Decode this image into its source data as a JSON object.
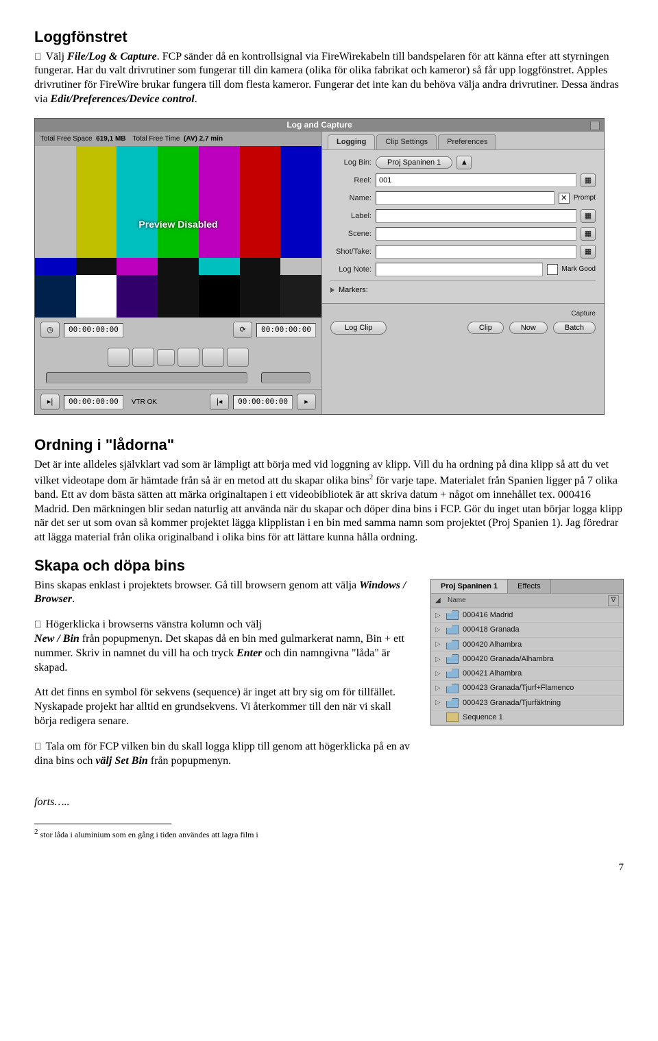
{
  "heading1": "Loggfönstret",
  "para1_prefix": " Välj ",
  "para1_cmd": "File/Log & Capture",
  "para1_body": ". FCP sänder då en kontrollsignal via FireWirekabeln till bandspelaren för att känna efter att styrningen fungerar. Har du valt drivrutiner som fungerar till din kamera (olika för olika fabrikat och kameror) så får upp loggfönstret. Apples drivrutiner för FireWire brukar fungera till dom flesta kameror. Fungerar det inte kan du behöva välja andra drivrutiner. Dessa ändras via ",
  "para1_cmd2": "Edit/Preferences/Device control",
  "para1_end": ".",
  "logcap": {
    "title": "Log and Capture",
    "free_space_label": "Total Free Space",
    "free_space_value": "619,1 MB",
    "free_time_label": "Total Free Time",
    "free_time_value": "(AV) 2,7 min",
    "preview_disabled": "Preview Disabled",
    "tc_left": "00:00:00:00",
    "tc_right": "00:00:00:00",
    "tc_in": "00:00:00:00",
    "tc_out": "00:00:00:00",
    "vtr_status": "VTR OK",
    "tabs": {
      "logging": "Logging",
      "clip_settings": "Clip Settings",
      "preferences": "Preferences"
    },
    "fields": {
      "log_bin": "Log Bin:",
      "log_bin_value": "Proj Spaninen 1",
      "reel": "Reel:",
      "reel_value": "001",
      "name": "Name:",
      "label": "Label:",
      "scene": "Scene:",
      "shot_take": "Shot/Take:",
      "log_note": "Log Note:",
      "prompt": "Prompt",
      "mark_good": "Mark Good",
      "markers": "Markers:"
    },
    "capture": {
      "title": "Capture",
      "log_clip": "Log Clip",
      "clip": "Clip",
      "now": "Now",
      "batch": "Batch"
    }
  },
  "heading2": "Ordning i \"lådorna\"",
  "para2": "Det är inte alldeles självklart vad som är lämpligt att börja med vid loggning av klipp. Vill du ha ordning på dina klipp så att du vet vilket videotape dom är hämtade från så är en metod att du skapar olika bins",
  "para2_sup": "2",
  "para2_cont": " för varje tape. Materialet från Spanien ligger på 7 olika band. Ett av dom bästa sätten att märka originaltapen i ett videobibliotek är att skriva datum + något om innehållet tex. 000416 Madrid. Den märkningen blir sedan naturlig att använda när du skapar och döper dina bins i FCP. Gör du inget utan börjar logga klipp när det ser ut som ovan så kommer projektet lägga klipplistan i en bin med samma namn som projektet (Proj Spanien 1). Jag föredrar att lägga material från olika originalband i olika bins för att lättare kunna hålla ordning.",
  "heading3": "Skapa och döpa bins",
  "para3a": "Bins skapas enklast i projektets browser. Gå till browsern genom att välja ",
  "para3a_cmd": "Windows / Browser",
  "para3a_end": ".",
  "para3b_prefix": " Högerklicka i browserns vänstra kolumn och välj ",
  "para3b_cmd": "New / Bin",
  "para3b_mid": " från popupmenyn. Det skapas då en bin med gulmarkerat namn, Bin + ett nummer. Skriv in namnet du vill ha och tryck ",
  "para3b_cmd2": "Enter",
  "para3b_end": " och din namngivna \"låda\" är skapad.",
  "para3c": "Att det finns en symbol för sekvens (sequence) är inget att bry sig om för tillfället. Nyskapade projekt har alltid en grundsekvens. Vi återkommer till den när vi skall börja redigera senare.",
  "para3d_prefix": " Tala om för FCP vilken bin du skall logga klipp till genom att högerklicka på en av dina bins och ",
  "para3d_cmd": "välj Set Bin",
  "para3d_end": " från popupmenyn.",
  "browser": {
    "tab1": "Proj Spaninen 1",
    "tab2": "Effects",
    "col_name": "Name",
    "col_v": "∇",
    "items": [
      {
        "icon": "bin",
        "name": "000416 Madrid"
      },
      {
        "icon": "bin",
        "name": "000418 Granada"
      },
      {
        "icon": "bin",
        "name": "000420 Alhambra"
      },
      {
        "icon": "bin",
        "name": "000420 Granada/Alhambra"
      },
      {
        "icon": "bin",
        "name": "000421 Alhambra"
      },
      {
        "icon": "bin",
        "name": "000423 Granada/Tjurf+Flamenco"
      },
      {
        "icon": "bin",
        "name": "000423 Granada/Tjurfäktning"
      },
      {
        "icon": "seq",
        "name": "Sequence 1"
      }
    ]
  },
  "forts": "forts…..",
  "footnote_num": "2",
  "footnote_text": " stor låda i aluminium som en gång i tiden användes att lagra film i",
  "page_number": "7"
}
